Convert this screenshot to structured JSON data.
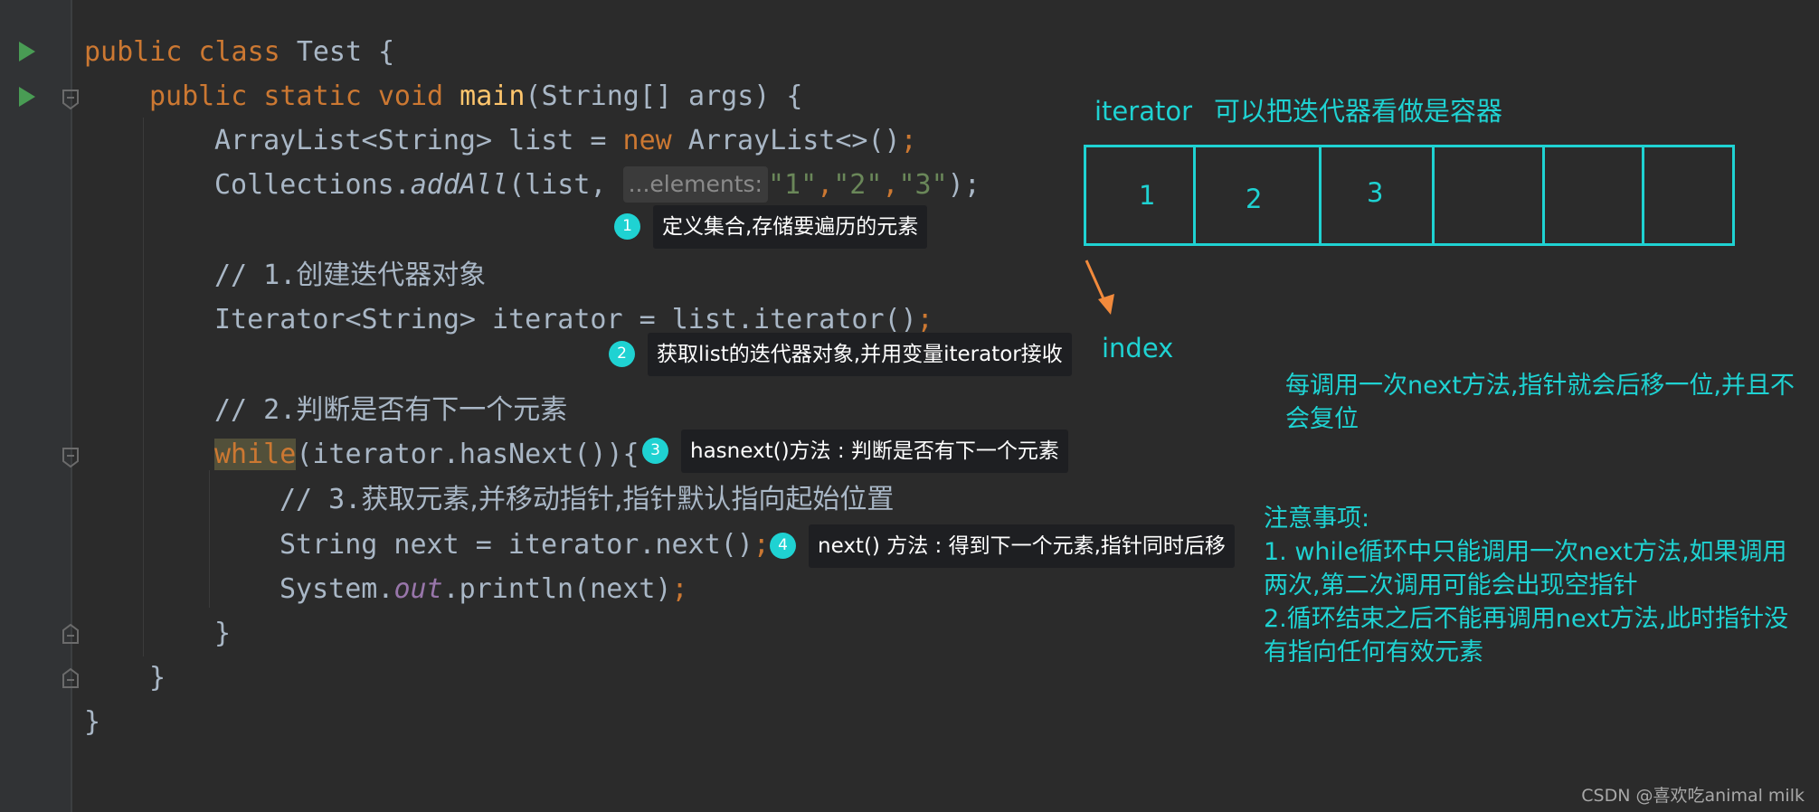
{
  "code": {
    "l1": {
      "a": "public class ",
      "b": "Test {"
    },
    "l2": {
      "a": "public static void ",
      "b": "main",
      "c": "(String[] args) {"
    },
    "l3": {
      "a": "ArrayList<String> list = ",
      "b": "new ",
      "c": "ArrayList<>()",
      "d": ";"
    },
    "l4": {
      "a": "Collections.",
      "b": "addAll",
      "c": "(list, ",
      "hint": "...elements:",
      "d": "\"1\"",
      "e": ",",
      "f": "\"2\"",
      "g": ",",
      "h": "\"3\"",
      "i": ");"
    },
    "l6": {
      "a": "// 1.",
      "b": "创建迭代器对象"
    },
    "l7": {
      "a": "Iterator<String> iterator = list.iterator()",
      "b": ";"
    },
    "l9": {
      "a": "// 2.",
      "b": "判断是否有下一个元素"
    },
    "l10": {
      "a": "while",
      "b": "(iterator.hasNext()){"
    },
    "l11": {
      "a": "// 3.",
      "b": "获取元素,并移动指针,指针默认指向起始位置"
    },
    "l12": {
      "a": "String next = iterator.next()",
      "b": ";"
    },
    "l13": {
      "a": "System.",
      "b": "out",
      "c": ".println(next)",
      "d": ";"
    },
    "l14": "}",
    "l15": "}",
    "l16": "}"
  },
  "callouts": [
    {
      "num": "1",
      "text": "定义集合,存储要遍历的元素"
    },
    {
      "num": "2",
      "text": "获取list的迭代器对象,并用变量iterator接收"
    },
    {
      "num": "3",
      "text": "hasnext()方法 : 判断是否有下一个元素"
    },
    {
      "num": "4",
      "text": "next() 方法 : 得到下一个元素,指针同时后移"
    }
  ],
  "diagram": {
    "title_a": "iterator",
    "title_b": "可以把迭代器看做是容器",
    "cells": [
      "1",
      "2",
      "3",
      "",
      "",
      ""
    ],
    "pointer_label": "index",
    "note1": [
      "每调用一次next方法,指针就会后移一位,并且不",
      "会复位"
    ],
    "note2": [
      "注意事项:",
      "1. while循环中只能调用一次next方法,如果调用",
      "两次,第二次调用可能会出现空指针",
      "2.循环结束之后不能再调用next方法,此时指针没",
      "有指向任何有效元素"
    ]
  },
  "watermark": "CSDN @喜欢吃animal milk",
  "colors": {
    "background": "#2b2b2b",
    "keyword": "#cc7832",
    "method": "#ffc66d",
    "string": "#6a8759",
    "annotation": "#1fd2d2"
  }
}
